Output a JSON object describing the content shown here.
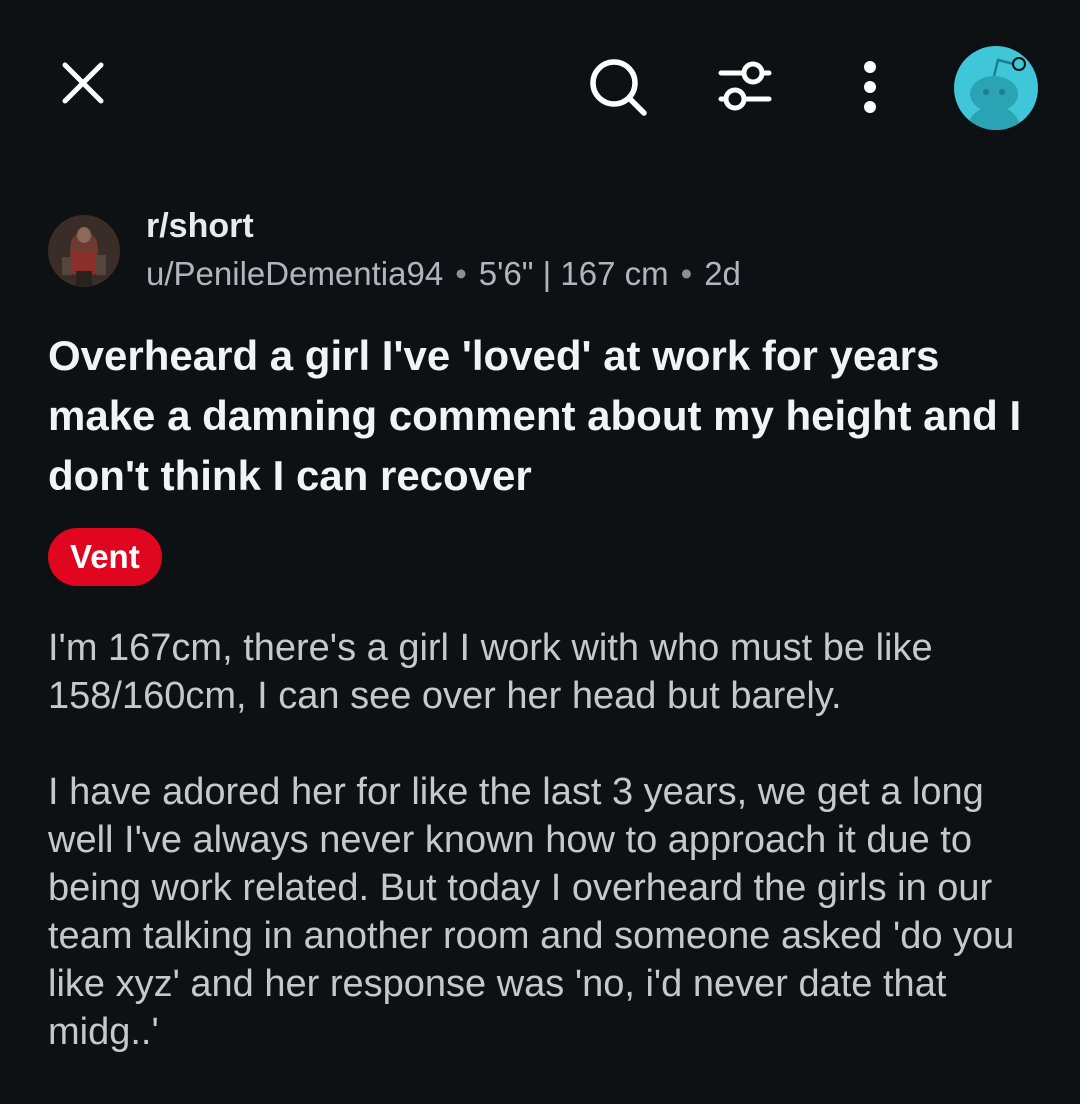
{
  "topbar": {
    "close_icon": "close-icon",
    "search_icon": "search-icon",
    "filter_icon": "filter-icon",
    "more_icon": "more-vertical-icon",
    "user_avatar": "user-avatar",
    "avatar_color": "#3fc6d8"
  },
  "post": {
    "subreddit": "r/short",
    "author": "u/PenileDementia94",
    "user_flair": "5'6\" | 167 cm",
    "age": "2d",
    "separator": "•",
    "title": "Overheard a girl I've 'loved' at work for years make a damning comment about my height and I don't think I can recover",
    "flair": "Vent",
    "flair_color": "#e0061f",
    "body": [
      "I'm 167cm, there's a girl I work with who must be like 158/160cm, I can see over her head but barely.",
      "I have adored her for like the last 3 years, we get a long well I've always never known how to approach it due to being work related. But today I overheard the girls in our team talking in another room and someone asked 'do you like xyz' and her response was 'no, i'd never date that midg..'"
    ]
  }
}
